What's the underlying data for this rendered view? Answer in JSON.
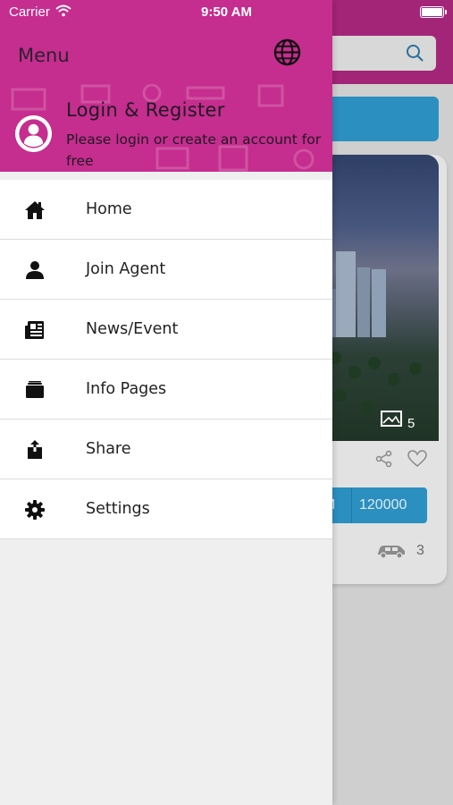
{
  "status_bar": {
    "carrier": "Carrier",
    "time": "9:50 AM"
  },
  "drawer": {
    "title": "Menu",
    "language_icon": "globe-icon",
    "login": {
      "title": "Login & Register",
      "subtitle": "Please login or create an account for free",
      "avatar_icon": "user-avatar-icon"
    },
    "items": [
      {
        "label": "Home",
        "icon": "home-icon"
      },
      {
        "label": "Join Agent",
        "icon": "person-icon"
      },
      {
        "label": "News/Event",
        "icon": "newspaper-icon"
      },
      {
        "label": "Info Pages",
        "icon": "folder-icon"
      },
      {
        "label": "Share",
        "icon": "share-icon"
      },
      {
        "label": "Settings",
        "icon": "gear-icon"
      }
    ]
  },
  "background_app": {
    "photo_count": "5",
    "price_unit": "M",
    "price_value": "120000",
    "parking_count": "3"
  },
  "colors": {
    "brand": "#c52d8e",
    "brand_dim": "#a32577",
    "accent_blue": "#2b8fc0"
  }
}
